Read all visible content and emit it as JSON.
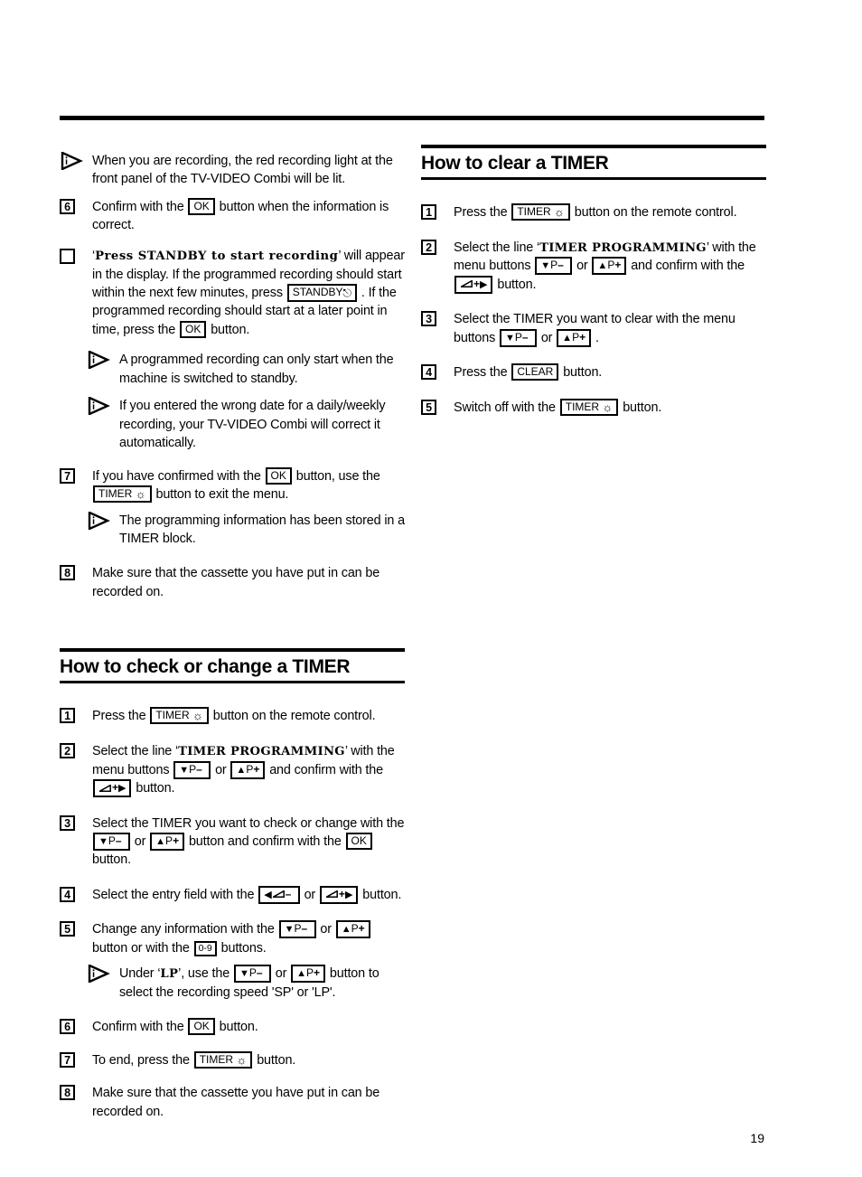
{
  "page": {
    "number": "19"
  },
  "left_column": {
    "note_recording_light": "When you are recording, the red recording light at the front panel of the TV-VIDEO Combi will be lit.",
    "step6_num": "6",
    "step6_a": "Confirm with the",
    "step6_key_ok": "OK",
    "step6_b": "button when the information is correct.",
    "box_display_text": "Press STANDBY to start recording",
    "box_a": "will appear in the display. If the programmed recording should start within the next few minutes, press",
    "box_key_standby": "STANDBY",
    "box_b": ". If the programmed recording should start at a later point in time, press the",
    "box_key_ok": "OK",
    "box_c": "button.",
    "note_standby": "A programmed recording can only start when the machine is switched to standby.",
    "note_wrong_date": "If you entered the wrong date for a daily/weekly recording, your TV-VIDEO Combi will correct it automatically.",
    "step7_num": "7",
    "step7_a": "If you have confirmed with the",
    "step7_key_ok": "OK",
    "step7_b": "button, use the",
    "step7_key_timer": "TIMER",
    "step7_c": "button to exit the menu.",
    "note_stored": "The programming information has been stored in a TIMER block.",
    "step8_num": "8",
    "step8_text": "Make sure that the cassette you have put in can be recorded on.",
    "heading": "How to check or change a TIMER",
    "c_step1_num": "1",
    "c_step1_a": "Press the",
    "c_step1_key_timer": "TIMER",
    "c_step1_b": "button on the remote control.",
    "c_step2_num": "2",
    "c_step2_a": "Select the line",
    "c_step2_display": "TIMER  PROGRAMMING",
    "c_step2_b": "with the menu buttons",
    "c_step2_key_pdown": "P",
    "c_step2_key_pup": "P",
    "c_step2_c": "and confirm with the",
    "c_step2_key_volup": "+",
    "c_step2_d": "button.",
    "c_step3_num": "3",
    "c_step3_a": "Select the TIMER you want to check or change with the",
    "c_step3_key_pdown": "P",
    "c_step3_or": "or",
    "c_step3_key_pup": "P",
    "c_step3_b": "button and confirm with the",
    "c_step3_key_ok": "OK",
    "c_step3_c": "button.",
    "c_step4_num": "4",
    "c_step4_a": "Select the entry field with the",
    "c_step4_key_voldown": "–",
    "c_step4_or": "or",
    "c_step4_key_volup": "+",
    "c_step4_b": "button.",
    "c_step5_num": "5",
    "c_step5_a": "Change any information with the",
    "c_step5_key_pdown": "P",
    "c_step5_or": "or",
    "c_step5_key_pup": "P",
    "c_step5_b": "button or with the",
    "c_step5_key_digits": "0-9",
    "c_step5_c": "buttons.",
    "c_note_a": "Under",
    "c_note_display_lp": "LP",
    "c_note_b": ", use the",
    "c_note_key_pdown": "P",
    "c_note_or": "or",
    "c_note_key_pup": "P",
    "c_note_c": "button to select the recording speed 'SP' or 'LP'.",
    "c_step6_num": "6",
    "c_step6_a": "Confirm with the",
    "c_step6_key_ok": "OK",
    "c_step6_b": "button.",
    "c_step7_num": "7",
    "c_step7_a": "To end, press the",
    "c_step7_key_timer": "TIMER",
    "c_step7_b": "button.",
    "c_step8_num": "8",
    "c_step8_text": "Make sure that the cassette you have put in can be recorded on."
  },
  "right_column": {
    "heading": "How to clear a TIMER",
    "step1_num": "1",
    "step1_a": "Press the",
    "step1_key_timer": "TIMER",
    "step1_b": "button on the remote control.",
    "step2_num": "2",
    "step2_a": "Select the line",
    "step2_display": "TIMER  PROGRAMMING",
    "step2_b": "with the menu buttons",
    "step2_key_pdown": "P",
    "step2_or": "or",
    "step2_key_pup": "P",
    "step2_c": "and confirm with the",
    "step2_key_volup": "+",
    "step2_d": "button.",
    "step3_num": "3",
    "step3_a": "Select the TIMER you want to clear with the menu buttons",
    "step3_key_pdown": "P",
    "step3_or": "or",
    "step3_key_pup": "P",
    "step3_b": ".",
    "step4_num": "4",
    "step4_a": "Press the",
    "step4_key_clear": "CLEAR",
    "step4_b": "button.",
    "step5_num": "5",
    "step5_a": "Switch off with the",
    "step5_key_timer": "TIMER",
    "step5_b": "button."
  },
  "glyphs": {
    "power_symbol": "⏻",
    "clock_symbol": "⊙",
    "triangle_down": "▼",
    "triangle_up": "▲",
    "arrow_left": "◀",
    "arrow_right": "▶",
    "minus": "–",
    "plus": "+"
  }
}
